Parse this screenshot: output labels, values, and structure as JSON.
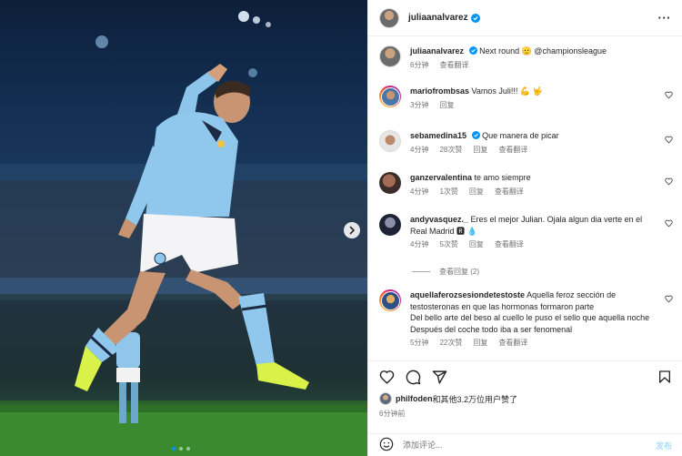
{
  "header": {
    "username": "juliaanalvarez",
    "more_icon": "more-horizontal-icon"
  },
  "caption": {
    "username": "juliaanalvarez",
    "text": "Next round 🫡 @championsleague",
    "time": "6分钟",
    "reply": "查看翻译"
  },
  "comments": [
    {
      "username": "mariofrombsas",
      "text": "Vamos Juli!!! 💪 🤟",
      "time": "3分钟",
      "likes": "",
      "reply": "回复",
      "translate": ""
    },
    {
      "username": "sebamedina15",
      "verified": true,
      "text": "Que manera de picar",
      "time": "4分钟",
      "likes": "28次赞",
      "reply": "回复",
      "translate": "查看翻译"
    },
    {
      "username": "ganzervalentina",
      "text": "te amo siempre",
      "time": "4分钟",
      "likes": "1次赞",
      "reply": "回复",
      "translate": "查看翻译"
    },
    {
      "username": "andyvasquez._",
      "text": "Eres el mejor Julian. Ojala algun dia verte en el Real Madrid 🆁 💧",
      "time": "4分钟",
      "likes": "5次赞",
      "reply": "回复",
      "translate": "查看翻译"
    },
    {
      "username": "aquellaferozsesiondetestoste",
      "text_lines": [
        "Aquella feroz sección de testosteronas en que las hormonas formaron parte",
        "Del bello arte del beso al cuello le puso el sello que aquella noche",
        "Después del coche todo iba a ser fenomenal"
      ],
      "time": "5分钟",
      "likes": "22次赞",
      "reply": "回复",
      "translate": "查看翻译"
    }
  ],
  "view_replies": "查看回复 (2)",
  "likes": {
    "user": "philfoden",
    "text": "和其他3.2万位用户赞了"
  },
  "post_time": "6分钟前",
  "composer": {
    "placeholder": "添加评论...",
    "post_label": "发布"
  },
  "colors": {
    "accent": "#0095f6",
    "muted": "#737373",
    "text": "#262626"
  }
}
